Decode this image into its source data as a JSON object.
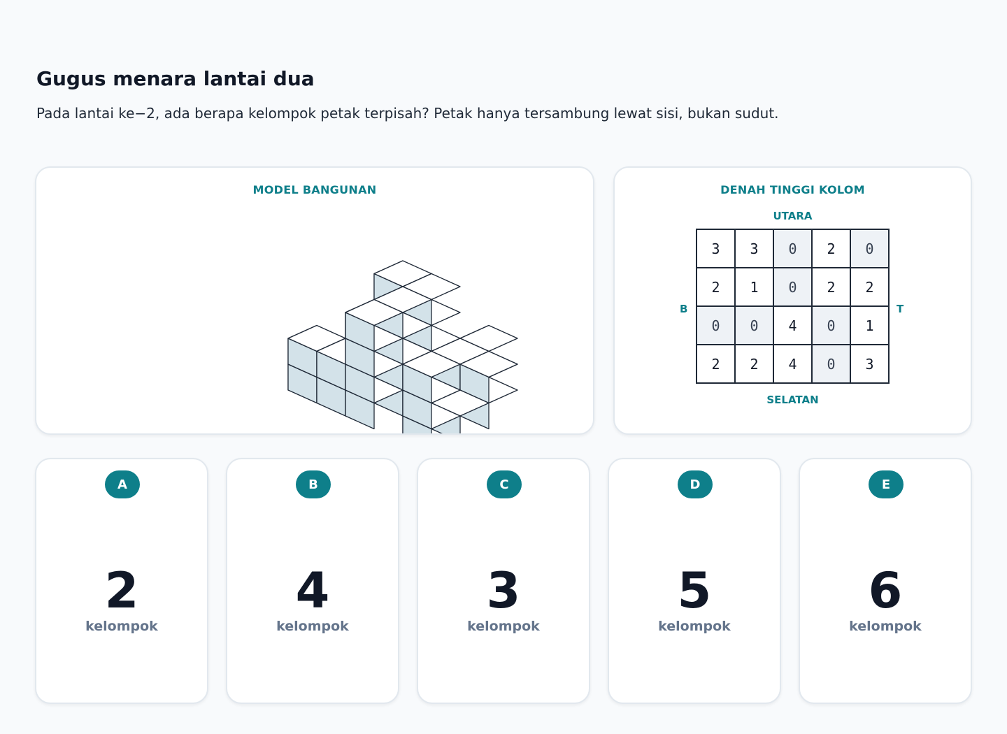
{
  "title": "Gugus menara lantai dua",
  "question": "Pada lantai ke−2, ada berapa kelompok petak terpisah? Petak hanya tersambung lewat sisi, bukan sudut.",
  "model_panel": {
    "title": "MODEL BANGUNAN"
  },
  "map_panel": {
    "title": "DENAH TINGGI KOLOM",
    "north": "UTARA",
    "south": "SELATAN",
    "west": "B",
    "east": "T"
  },
  "height_map": [
    [
      3,
      3,
      0,
      2,
      0
    ],
    [
      2,
      1,
      0,
      2,
      2
    ],
    [
      0,
      0,
      4,
      0,
      1
    ],
    [
      2,
      2,
      4,
      0,
      3
    ]
  ],
  "colors": {
    "accent": "#0e7f8a",
    "cube_top": "#ffffff",
    "cube_left": "#e9eff3",
    "cube_right": "#d3e2e9",
    "empty_cell": "#eef2f6"
  },
  "options": [
    {
      "letter": "A",
      "value": "2",
      "unit": "kelompok"
    },
    {
      "letter": "B",
      "value": "4",
      "unit": "kelompok"
    },
    {
      "letter": "C",
      "value": "3",
      "unit": "kelompok"
    },
    {
      "letter": "D",
      "value": "5",
      "unit": "kelompok"
    },
    {
      "letter": "E",
      "value": "6",
      "unit": "kelompok"
    }
  ]
}
